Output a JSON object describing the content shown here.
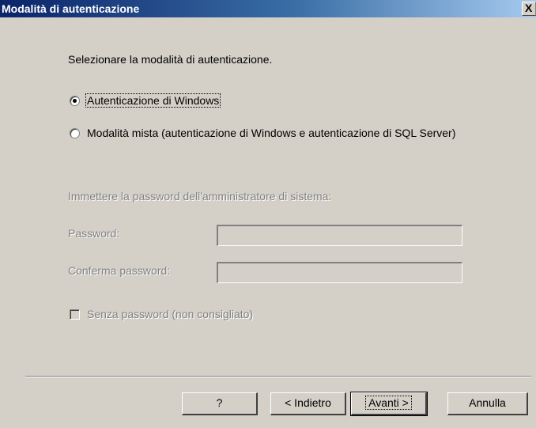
{
  "window": {
    "title": "Modalità di autenticazione",
    "close_label": "X"
  },
  "prompt": "Selezionare la modalità di autenticazione.",
  "auth_options": [
    {
      "label": "Autenticazione di Windows",
      "selected": true
    },
    {
      "label": "Modalità mista (autenticazione di Windows e autenticazione di SQL Server)",
      "selected": false
    }
  ],
  "password_section": {
    "heading": "Immettere la password dell'amministratore di sistema:",
    "password_label": "Password:",
    "confirm_label": "Conferma password:",
    "password_value": "",
    "confirm_value": "",
    "no_password_label": "Senza password (non consigliato)",
    "no_password_checked": false
  },
  "buttons": {
    "help": "?",
    "back": "< Indietro",
    "next": "Avanti >",
    "cancel": "Annulla"
  }
}
